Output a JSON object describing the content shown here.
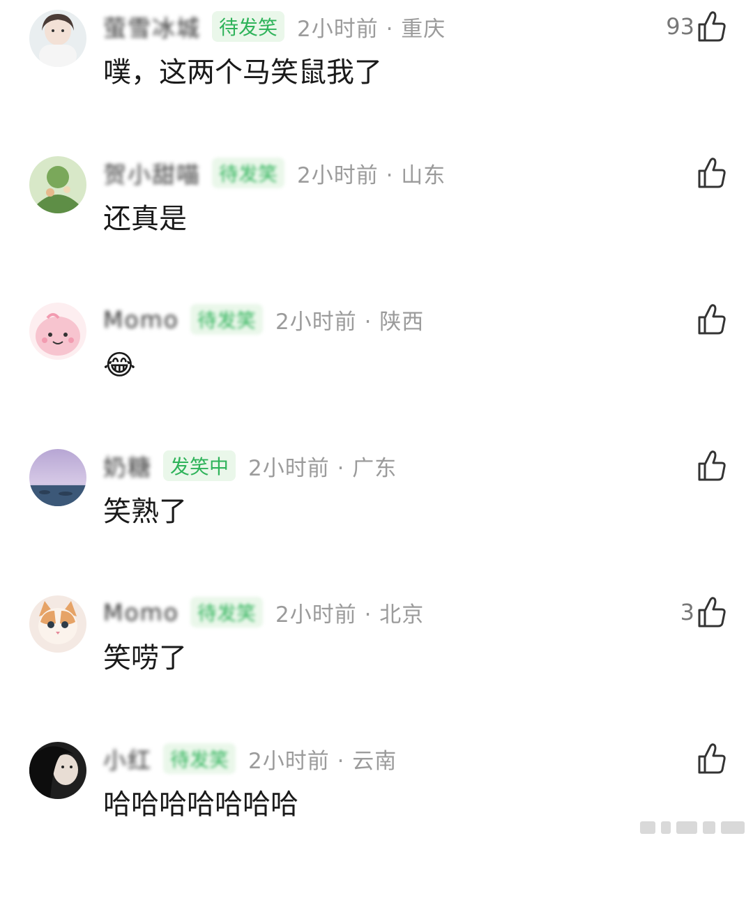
{
  "comments": [
    {
      "username": "萤雪冰城",
      "badge": "待发笑",
      "time_location": "2小时前 · 重庆",
      "text": "噗，这两个马笑鼠我了",
      "likes": "93",
      "avatar": "avatar-girl-white-top",
      "badge_blurred": false
    },
    {
      "username": "贺小甜喵",
      "badge": "待发笑",
      "time_location": "2小时前 · 山东",
      "text": "还真是",
      "likes": "",
      "avatar": "avatar-green-illustration",
      "badge_blurred": true
    },
    {
      "username": "Momo",
      "badge": "待发笑",
      "time_location": "2小时前 · 陕西",
      "text": "😂",
      "likes": "",
      "avatar": "avatar-pink-cartoon",
      "badge_blurred": true
    },
    {
      "username": "奶糖",
      "badge": "发笑中",
      "time_location": "2小时前 · 广东",
      "text": "笑熟了",
      "likes": "",
      "avatar": "avatar-purple-sky",
      "badge_blurred": false
    },
    {
      "username": "Momo",
      "badge": "待发笑",
      "time_location": "2小时前 · 北京",
      "text": "笑唠了",
      "likes": "3",
      "avatar": "avatar-cat",
      "badge_blurred": true
    },
    {
      "username": "小红",
      "badge": "待发笑",
      "time_location": "2小时前 · 云南",
      "text": "哈哈哈哈哈哈哈",
      "likes": "",
      "avatar": "avatar-dark-portrait",
      "badge_blurred": true
    }
  ],
  "colors": {
    "badge_green": "#2fb35a",
    "badge_bg": "#eaf7ea",
    "meta_gray": "#9b9b9b",
    "text": "#1a1a1a"
  },
  "icons": {
    "like": "thumbs-up-icon"
  }
}
